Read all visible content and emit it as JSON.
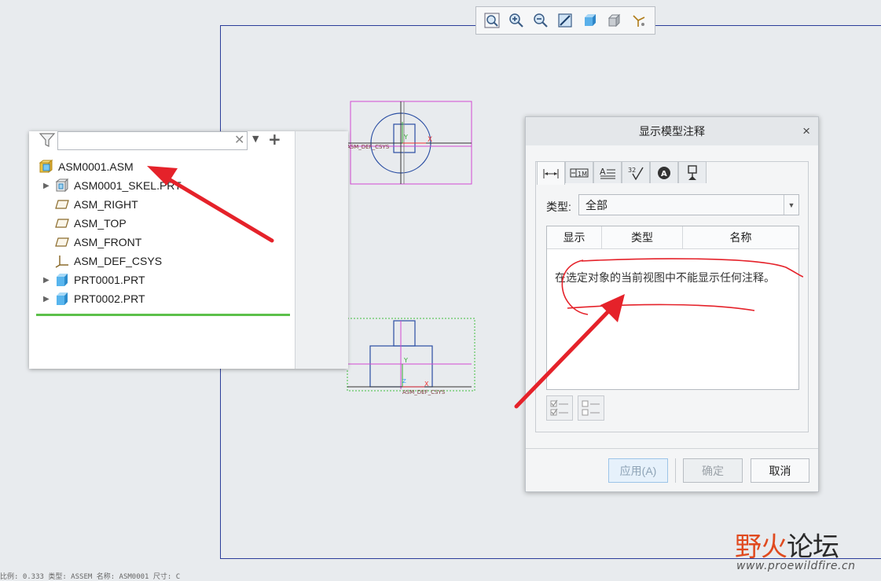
{
  "toolbar": {
    "buttons": [
      "zoom-fit-icon",
      "zoom-in-icon",
      "zoom-out-icon",
      "repaint-icon",
      "display-style-icon",
      "saved-views-icon",
      "datum-display-icon"
    ]
  },
  "tree": {
    "filter_value": "",
    "root": "ASM0001.ASM",
    "items": [
      "ASM0001_SKEL.PRT",
      "ASM_RIGHT",
      "ASM_TOP",
      "ASM_FRONT",
      "ASM_DEF_CSYS",
      "PRT0001.PRT",
      "PRT0002.PRT"
    ]
  },
  "drawing": {
    "top_view_label": "ASM_DEF_CSYS",
    "bottom_view_label": "ASM_DEF_CSYS",
    "axis_x": "X",
    "axis_y": "Y",
    "axis_z": "Z"
  },
  "dialog": {
    "title": "显示模型注释",
    "type_label": "类型:",
    "type_value": "全部",
    "columns": [
      "显示",
      "类型",
      "名称"
    ],
    "empty_message": "在选定对象的当前视图中不能显示任何注释。",
    "apply": "应用(A)",
    "ok": "确定",
    "cancel": "取消",
    "close_glyph": "×"
  },
  "status": "比例: 0.333   类型: ASSEM   名称: ASM0001   尺寸: C",
  "watermark": {
    "brand_a": "野火",
    "brand_b": "论坛",
    "url": "www.proewildfire.cn"
  },
  "colors": {
    "accent_red": "#e5222a",
    "magenta_frame": "#d24ad2",
    "green_frame": "#3fbf3f",
    "model_blue": "#2a4ea3"
  }
}
